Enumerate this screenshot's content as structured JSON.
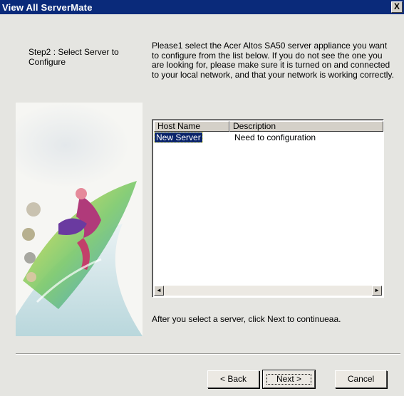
{
  "window": {
    "title": "View All ServerMate",
    "close_glyph": "X"
  },
  "step_label": "Step2 : Select Server to Configure",
  "instructions": "Please1 select the Acer Altos SA50 server appliance you want to configure from the list below. If you do not see the one you are looking for, please make sure it is turned on and connected to your local network, and that your network is working correctly.",
  "server_list": {
    "columns": [
      "Host Name",
      "Description"
    ],
    "rows": [
      {
        "host": "New Server",
        "description": "Need to configuration"
      }
    ],
    "scroll_left_glyph": "◄",
    "scroll_right_glyph": "►"
  },
  "after_text": "After you select a server, click Next to continueaa.",
  "buttons": {
    "back": "< Back",
    "next": "Next >",
    "cancel": "Cancel"
  },
  "colors": {
    "titlebar": "#0a2a7a",
    "dialog_bg": "#e5e5e1",
    "selection": "#0a246a"
  },
  "icons": {
    "side_art": "surfer-illustration"
  }
}
